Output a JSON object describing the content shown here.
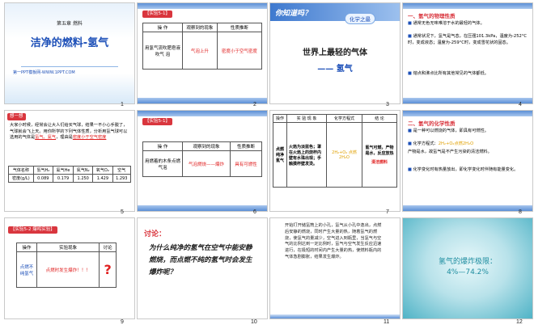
{
  "colors": {
    "accent_blue": "#1c4fb8",
    "accent_red": "#e02020",
    "banner": "#5b8fd6",
    "tag_red": "#d9363e",
    "water_teal": "#1e8da0"
  },
  "slides": [
    {
      "n": "1",
      "chapter": "第五章 燃料",
      "title": "洁净的燃料-氢气",
      "link": "第一PPT模板网-WWW.1PPT.COM"
    },
    {
      "n": "2",
      "tag": "【实验5-1】",
      "head": [
        "操 作",
        "观察到的现象",
        "性质推断"
      ],
      "op": "用氢气流吹肥皂液吹气 泡",
      "obs": "气泡上升",
      "inf": "密度小于空气密度"
    },
    {
      "n": "3",
      "q": "你知道吗？",
      "badge": "化学之最",
      "line1": "世界上最轻的气体",
      "line2": "—— 氢气"
    },
    {
      "n": "4",
      "sec": "一、氢气的物理性质",
      "b1": "通常无色无味难溶于水的最轻的气体。",
      "b2": "通常状况下，氢气是气态，在压强101.3kPa，温度为-252°C时，变成液态；温度为-259°C时，变成雪花状的固态。",
      "b3": "熔点和沸点比所有其他常见的气体都低。"
    },
    {
      "n": "5",
      "badge": "想一想",
      "text": "大家小时候，经常会让大人们给买气球，结果一不小心手脱了，气球就会飞上天。用你所学的下列气体性质，分析用氢气球可以选用的气体是",
      "ans1": "氢气、氦气",
      "why": "，理由是",
      "ans2": "密度小于空气密度",
      "table_head": [
        "气体名称",
        "氢气H₂",
        "氦气He",
        "氮气N₂",
        "氧气O₂",
        "空气"
      ],
      "row_label": "密度(g/L)",
      "row": [
        "0.089",
        "0.179",
        "1.250",
        "1.429",
        "1.293"
      ]
    },
    {
      "n": "6",
      "tag": "【实验5-1】",
      "head": [
        "操 作",
        "观察到的现象",
        "性质推断"
      ],
      "op": "用燃着的木条点燃气泡",
      "obs": "气泡燃烧——爆炸",
      "inf": "具有可燃性"
    },
    {
      "n": "7",
      "head": [
        "操作",
        "实 验 现 象",
        "化学方程式",
        "结 论"
      ],
      "op": "点燃纯净氢气",
      "obs": "火焰为淡蓝色；罩在火焰上的烧杯内壁有水珠出现；手触摸杯壁发烫。",
      "eq": "2H₂+O₂ 点燃 2H₂O",
      "con1": "氢气可燃，产物是水，反应放热",
      "con2": "清洁燃料"
    },
    {
      "n": "8",
      "sec": "二、氢气的化学性质",
      "b1": "是一种可以燃烧的气体，即具有可燃性。",
      "b2a": "化学方程式：",
      "b2b": "2H₂+O₂点燃2H₂O",
      "b3": "产物是水，故氢气是不产生污染的清洁燃料。",
      "b4": "化学变化时有热量放出，即化学变化时伴随有能量变化。"
    },
    {
      "n": "9",
      "tag": "【实验5-2 爆鸣实验】",
      "head": [
        "操作",
        "实验现象",
        "讨论"
      ],
      "op": "点燃不纯氢气",
      "obs": "点燃时发生爆炸！！！",
      "disc": "?"
    },
    {
      "n": "10",
      "label": "讨论：",
      "text": "为什么纯净的氢气在空气中能安静燃烧，而点燃不纯的氢气时会发生爆炸呢？"
    },
    {
      "n": "11",
      "text": "开始打开储氢筒上的小孔，氢气从小孔中逸出，点燃后安静的燃烧，同时产生大量的热，随着氢气的燃烧，使氢气的量减少，空气进入到瓶里，当氢气与空气的比例达到一定比例时，氢气与空气发生反应迅速进行，在极短的时间内产生大量的热，使燃料瓶内的气体急剧膨胀，结果发生爆炸。"
    },
    {
      "n": "12",
      "title": "氢气的爆炸极限：",
      "range": "4%—74.2%"
    }
  ]
}
